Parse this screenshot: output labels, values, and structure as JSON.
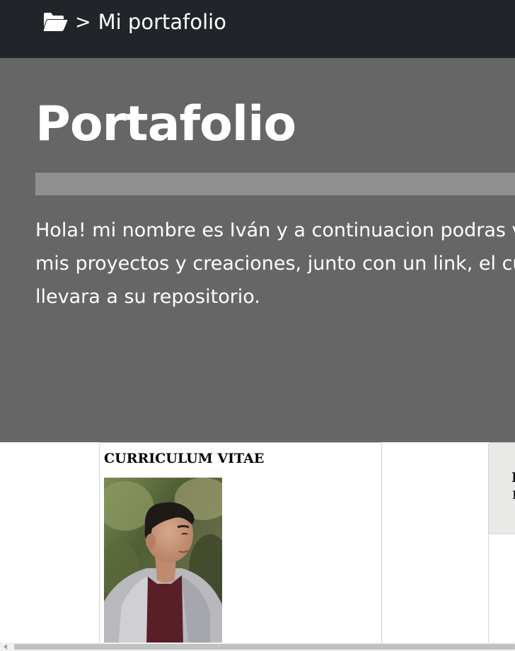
{
  "navbar": {
    "icon": "folder-open-icon",
    "separator": ">",
    "title": "Mi portafolio",
    "background": "#212529"
  },
  "hero": {
    "title": "Portafolio",
    "lead": "Hola! mi nombre es Iván y a continuacion podras ver mis proyectos y creaciones, junto con un link, el cual te llevara a su repositorio.",
    "background": "#666666"
  },
  "cards": [
    {
      "title": "CURRICULUM VITAE",
      "image": "profile-photo"
    },
    {
      "title": "",
      "image": ""
    }
  ],
  "scrollbar": {
    "left_arrow_icon": "chevron-left-icon"
  }
}
